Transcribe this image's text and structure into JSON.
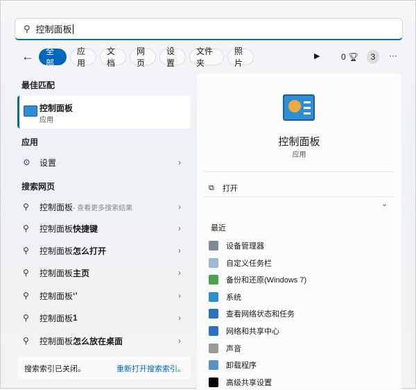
{
  "search": {
    "value": "控制面板"
  },
  "filters": [
    "全部",
    "应用",
    "文档",
    "网页",
    "设置",
    "文件夹",
    "照片"
  ],
  "toolbar": {
    "points": "0",
    "badge": "3",
    "more": "···"
  },
  "left": {
    "best_match_header": "最佳匹配",
    "best_match": {
      "title": "控制面板",
      "subtitle": "应用"
    },
    "apps_header": "应用",
    "apps": [
      {
        "label": "设置"
      }
    ],
    "web_header": "搜索网页",
    "web": [
      {
        "label": "控制面板",
        "suffix": " - 查看更多搜索结果"
      },
      {
        "label": "控制面板",
        "suffix": "快捷键"
      },
      {
        "label": "控制面板",
        "suffix": "怎么打开"
      },
      {
        "label": "控制面板",
        "suffix": "主页"
      },
      {
        "label": "控制面板",
        "suffix": " ‘’"
      },
      {
        "label": "控制面板",
        "suffix": "1"
      },
      {
        "label": "控制面板",
        "suffix": "怎么放在桌面"
      }
    ],
    "footer": {
      "text": "搜索索引已关闭。",
      "link": "重新打开搜索索引。"
    }
  },
  "right": {
    "title": "控制面板",
    "subtitle": "应用",
    "open": "打开",
    "recent_header": "最近",
    "recent": [
      {
        "label": "设备管理器",
        "color": "#7a8a99"
      },
      {
        "label": "自定义任务栏",
        "color": "#9db8d6"
      },
      {
        "label": "备份和还原(Windows 7)",
        "color": "#4aa34a"
      },
      {
        "label": "系统",
        "color": "#2b8fd6"
      },
      {
        "label": "查看网络状态和任务",
        "color": "#2a6fc0"
      },
      {
        "label": "网络和共享中心",
        "color": "#2a6fc0"
      },
      {
        "label": "声音",
        "color": "#9a9a9a"
      },
      {
        "label": "卸载程序",
        "color": "#5a8fc8"
      },
      {
        "label": "高级共享设置",
        "color": "#000000"
      }
    ]
  },
  "colors": {
    "accent": "#0067c0"
  }
}
